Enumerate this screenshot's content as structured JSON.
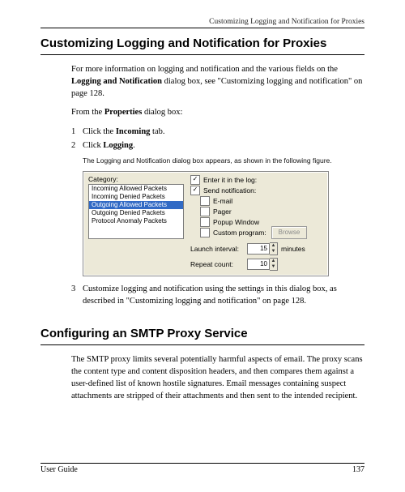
{
  "runningHead": "Customizing Logging and Notification for Proxies",
  "sect1Title": "Customizing Logging and Notification for Proxies",
  "p1_a": "For more information on logging and notification and the various fields on the ",
  "p1_b": "Logging and Notification",
  "p1_c": " dialog box, see \"Customizing logging and notification\" on page 128.",
  "p2_a": "From the ",
  "p2_b": "Properties",
  "p2_c": " dialog box:",
  "step1_a": "Click the ",
  "step1_b": "Incoming",
  "step1_c": " tab.",
  "step2_a": "Click ",
  "step2_b": "Logging",
  "step2_c": ".",
  "note": "The Logging and Notification dialog box appears, as shown in the following figure.",
  "dlg": {
    "categoryLabel": "Category:",
    "items": [
      "Incoming Allowed Packets",
      "Incoming Denied Packets",
      "Outgoing Allowed Packets",
      "Outgoing Denied Packets",
      "Protocol Anomaly Packets"
    ],
    "selectedIndex": 2,
    "enterInLog": "Enter it in the log:",
    "sendNotif": "Send notification:",
    "email": "E-mail",
    "pager": "Pager",
    "popup": "Popup Window",
    "custom": "Custom program:",
    "browse": "Browse",
    "launchLabel": "Launch interval:",
    "launchVal": "15",
    "launchUnit": "minutes",
    "repeatLabel": "Repeat count:",
    "repeatVal": "10"
  },
  "step3": "Customize logging and notification using the settings in this dialog box, as described in \"Customizing logging and notification\" on page 128.",
  "sect2Title": "Configuring an SMTP Proxy Service",
  "smtpPara": "The SMTP proxy limits several potentially harmful aspects of email. The proxy scans the content type and content disposition headers, and then compares them against a user-defined list of known hostile signatures. Email messages containing suspect attachments are stripped of their attachments and then sent to the intended recipient.",
  "footerLeft": "User Guide",
  "footerRight": "137"
}
